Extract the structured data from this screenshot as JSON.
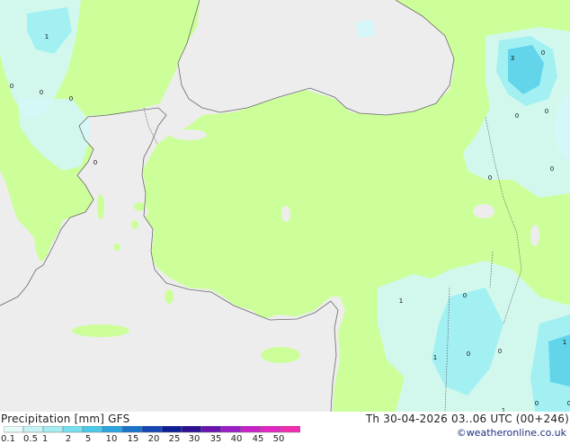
{
  "map": {
    "colors": {
      "sea": "#ededed",
      "land": "#ccff99",
      "coast": "#6a6a6a",
      "precip_light": "#d3f7f7",
      "precip_medium": "#9deef3",
      "precip_heavy": "#5bd2ea",
      "label": "#111111"
    },
    "precip_labels": [
      {
        "text": "1"
      },
      {
        "text": "0"
      },
      {
        "text": "0"
      },
      {
        "text": "0"
      },
      {
        "text": "0"
      },
      {
        "text": "3"
      },
      {
        "text": "0"
      },
      {
        "text": "0"
      },
      {
        "text": "0"
      },
      {
        "text": "0"
      },
      {
        "text": "0"
      },
      {
        "text": "0"
      },
      {
        "text": "1"
      },
      {
        "text": "0"
      },
      {
        "text": "1"
      },
      {
        "text": "0"
      },
      {
        "text": "0"
      },
      {
        "text": "1"
      },
      {
        "text": "1"
      },
      {
        "text": "0"
      }
    ]
  },
  "footer": {
    "title": "Precipitation [mm]  GFS",
    "valid_time": "Th 30-04-2026 03..06 UTC (00+246)",
    "credit": "©weatheronline.co.uk",
    "scale": {
      "colors": [
        "#e6fafa",
        "#c8f3f4",
        "#a5ecf1",
        "#78dfee",
        "#4cc8ea",
        "#2aa5e0",
        "#1a74cc",
        "#1446b4",
        "#0e1e96",
        "#2c1290",
        "#6a14b0",
        "#9a1ec4",
        "#c822c8",
        "#e426c0",
        "#f02cb0"
      ],
      "ticks": [
        "0.1",
        "0.5",
        "1",
        "2",
        "5",
        "10",
        "15",
        "20",
        "25",
        "30",
        "35",
        "40",
        "45",
        "50"
      ]
    }
  }
}
